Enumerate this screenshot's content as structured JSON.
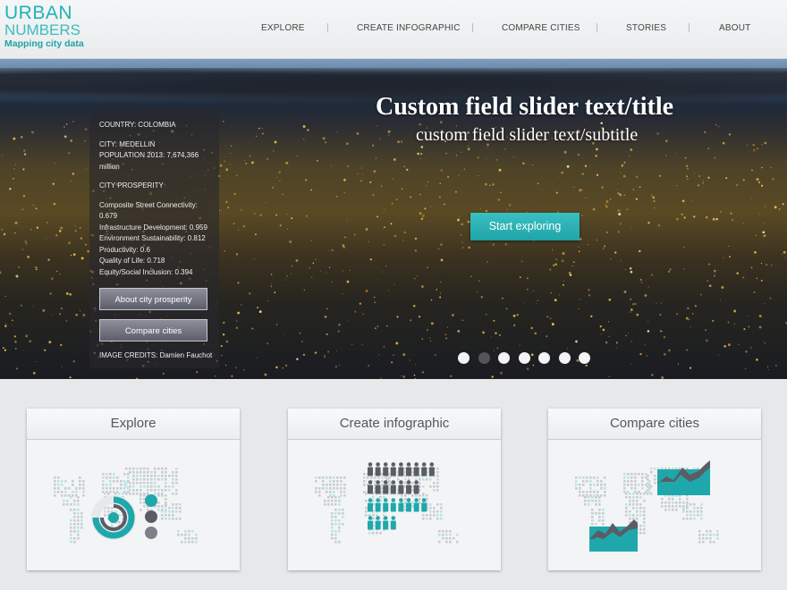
{
  "logo": {
    "line1": "URBAN",
    "line2": "NUMBERS",
    "tagline": "Mapping city data"
  },
  "nav": [
    {
      "label": "EXPLORE"
    },
    {
      "label": "CREATE INFOGRAPHIC"
    },
    {
      "label": "COMPARE CITIES"
    },
    {
      "label": "STORIES"
    },
    {
      "label": "ABOUT"
    }
  ],
  "hero": {
    "title": "Custom field slider text/title",
    "subtitle": "custom field slider text/subtitle",
    "cta": "Start exploring",
    "slides": 7,
    "active_slide": 2
  },
  "info": {
    "country": "COUNTRY:  COLOMBIA",
    "city": "CITY:  MEDELLIN",
    "population": "POPULATION 2013:  7,674,366 million",
    "prosperity_heading": "CITY PROSPERITY",
    "metrics": [
      "Composite Street Connectivity:  0.679",
      "Infrastructure Development:  0.959",
      "Environment Sustainability:  0.812",
      "Productivity:  0.6",
      "Quality of Life:  0.718",
      "Equity/Social Inclusion:  0.394"
    ],
    "about_btn": "About city prosperity",
    "compare_btn": "Compare cities",
    "credits": "IMAGE CREDITS:  Damien Fauchot"
  },
  "cards": [
    {
      "title": "Explore"
    },
    {
      "title": "Create infographic"
    },
    {
      "title": "Compare cities"
    }
  ],
  "colors": {
    "accent": "#1fb3b7",
    "text": "#444444",
    "card_bg": "#f3f4f5"
  }
}
